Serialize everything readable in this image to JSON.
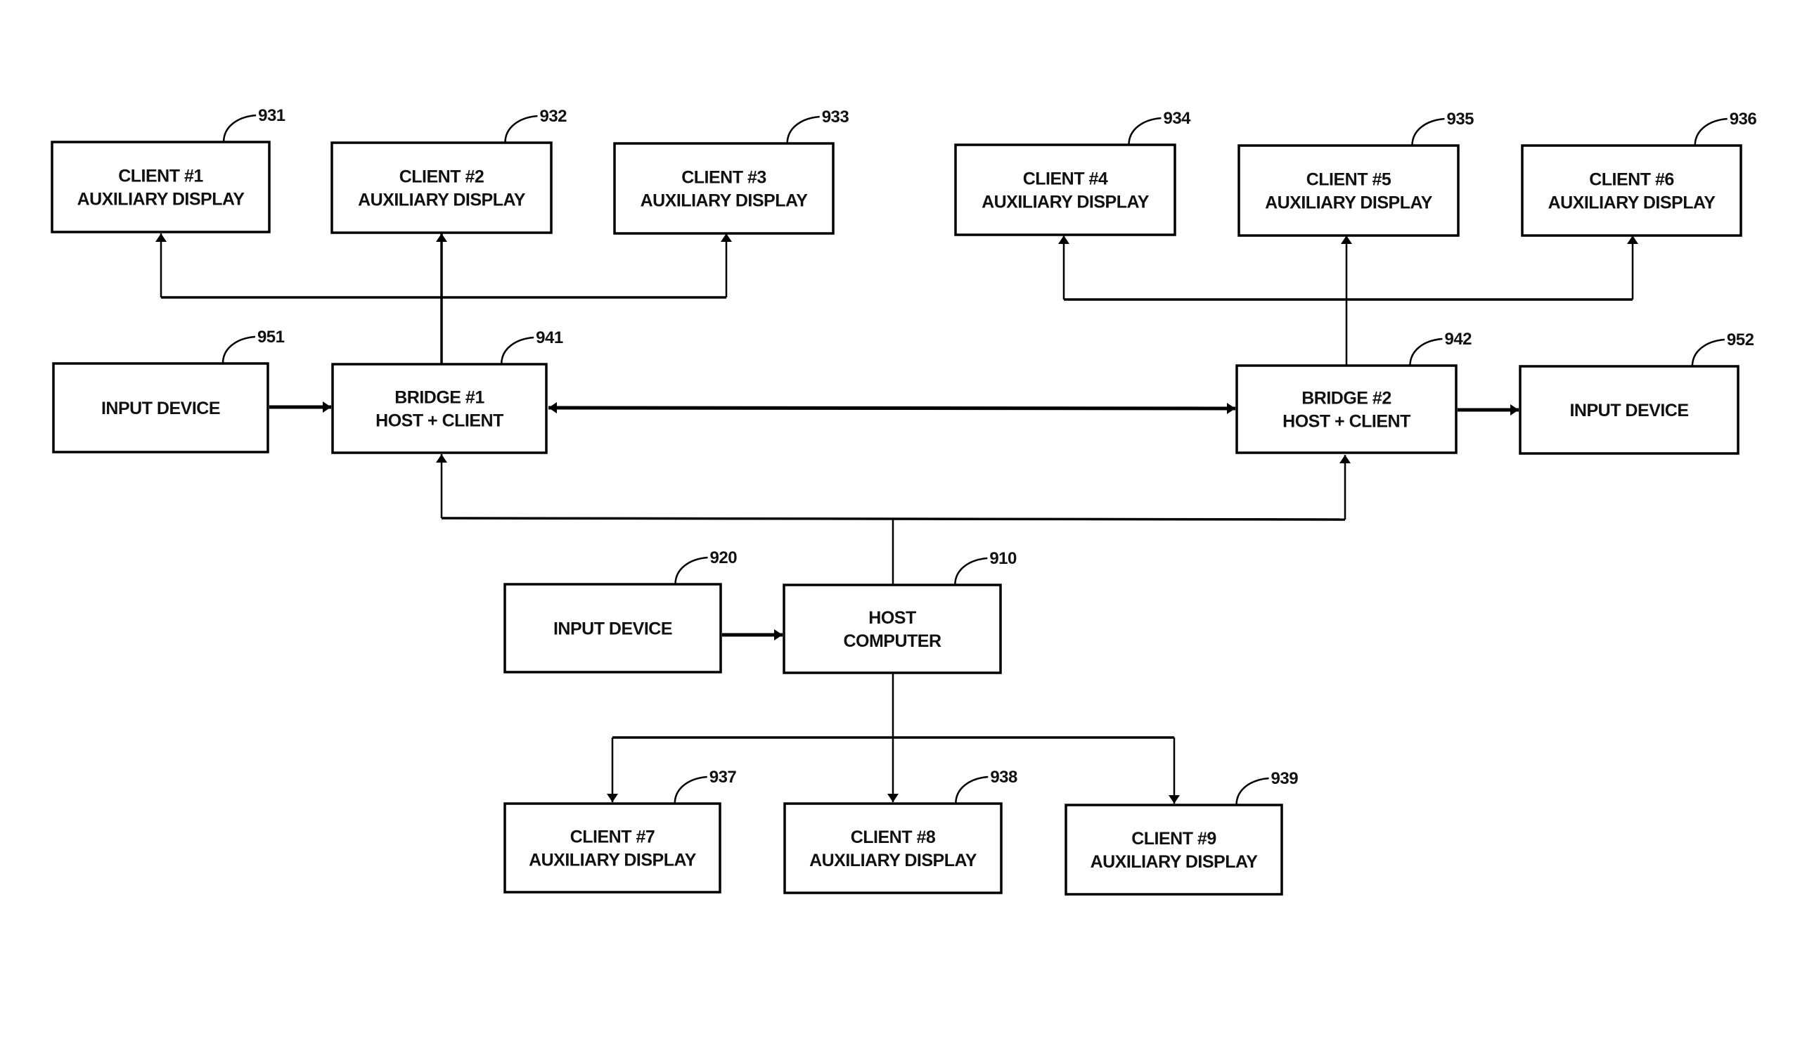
{
  "diagram": {
    "nodes": {
      "client1": {
        "ref": "931",
        "lines": [
          "CLIENT #1",
          "AUXILIARY DISPLAY"
        ]
      },
      "client2": {
        "ref": "932",
        "lines": [
          "CLIENT #2",
          "AUXILIARY DISPLAY"
        ]
      },
      "client3": {
        "ref": "933",
        "lines": [
          "CLIENT #3",
          "AUXILIARY DISPLAY"
        ]
      },
      "client4": {
        "ref": "934",
        "lines": [
          "CLIENT #4",
          "AUXILIARY DISPLAY"
        ]
      },
      "client5": {
        "ref": "935",
        "lines": [
          "CLIENT #5",
          "AUXILIARY DISPLAY"
        ]
      },
      "client6": {
        "ref": "936",
        "lines": [
          "CLIENT #6",
          "AUXILIARY DISPLAY"
        ]
      },
      "input951": {
        "ref": "951",
        "lines": [
          "INPUT DEVICE"
        ]
      },
      "bridge1": {
        "ref": "941",
        "lines": [
          "BRIDGE #1",
          "HOST + CLIENT"
        ]
      },
      "bridge2": {
        "ref": "942",
        "lines": [
          "BRIDGE #2",
          "HOST + CLIENT"
        ]
      },
      "input952": {
        "ref": "952",
        "lines": [
          "INPUT DEVICE"
        ]
      },
      "input920": {
        "ref": "920",
        "lines": [
          "INPUT DEVICE"
        ]
      },
      "host": {
        "ref": "910",
        "lines": [
          "HOST",
          "COMPUTER"
        ]
      },
      "client7": {
        "ref": "937",
        "lines": [
          "CLIENT #7",
          "AUXILIARY DISPLAY"
        ]
      },
      "client8": {
        "ref": "938",
        "lines": [
          "CLIENT #8",
          "AUXILIARY DISPLAY"
        ]
      },
      "client9": {
        "ref": "939",
        "lines": [
          "CLIENT #9",
          "AUXILIARY DISPLAY"
        ]
      }
    },
    "edges": [
      {
        "from": "bridge1",
        "to": "client1",
        "type": "arrow"
      },
      {
        "from": "bridge1",
        "to": "client2",
        "type": "arrow"
      },
      {
        "from": "bridge1",
        "to": "client3",
        "type": "arrow"
      },
      {
        "from": "bridge2",
        "to": "client4",
        "type": "arrow"
      },
      {
        "from": "bridge2",
        "to": "client5",
        "type": "arrow"
      },
      {
        "from": "bridge2",
        "to": "client6",
        "type": "arrow"
      },
      {
        "from": "input951",
        "to": "bridge1",
        "type": "arrow"
      },
      {
        "from": "bridge1",
        "to": "bridge2",
        "type": "bidirectional"
      },
      {
        "from": "bridge2",
        "to": "input952",
        "type": "arrow"
      },
      {
        "from": "host",
        "to": "bridge1",
        "type": "arrow"
      },
      {
        "from": "host",
        "to": "bridge2",
        "type": "arrow"
      },
      {
        "from": "input920",
        "to": "host",
        "type": "arrow"
      },
      {
        "from": "host",
        "to": "client7",
        "type": "arrow"
      },
      {
        "from": "host",
        "to": "client8",
        "type": "arrow"
      },
      {
        "from": "host",
        "to": "client9",
        "type": "arrow"
      }
    ]
  }
}
